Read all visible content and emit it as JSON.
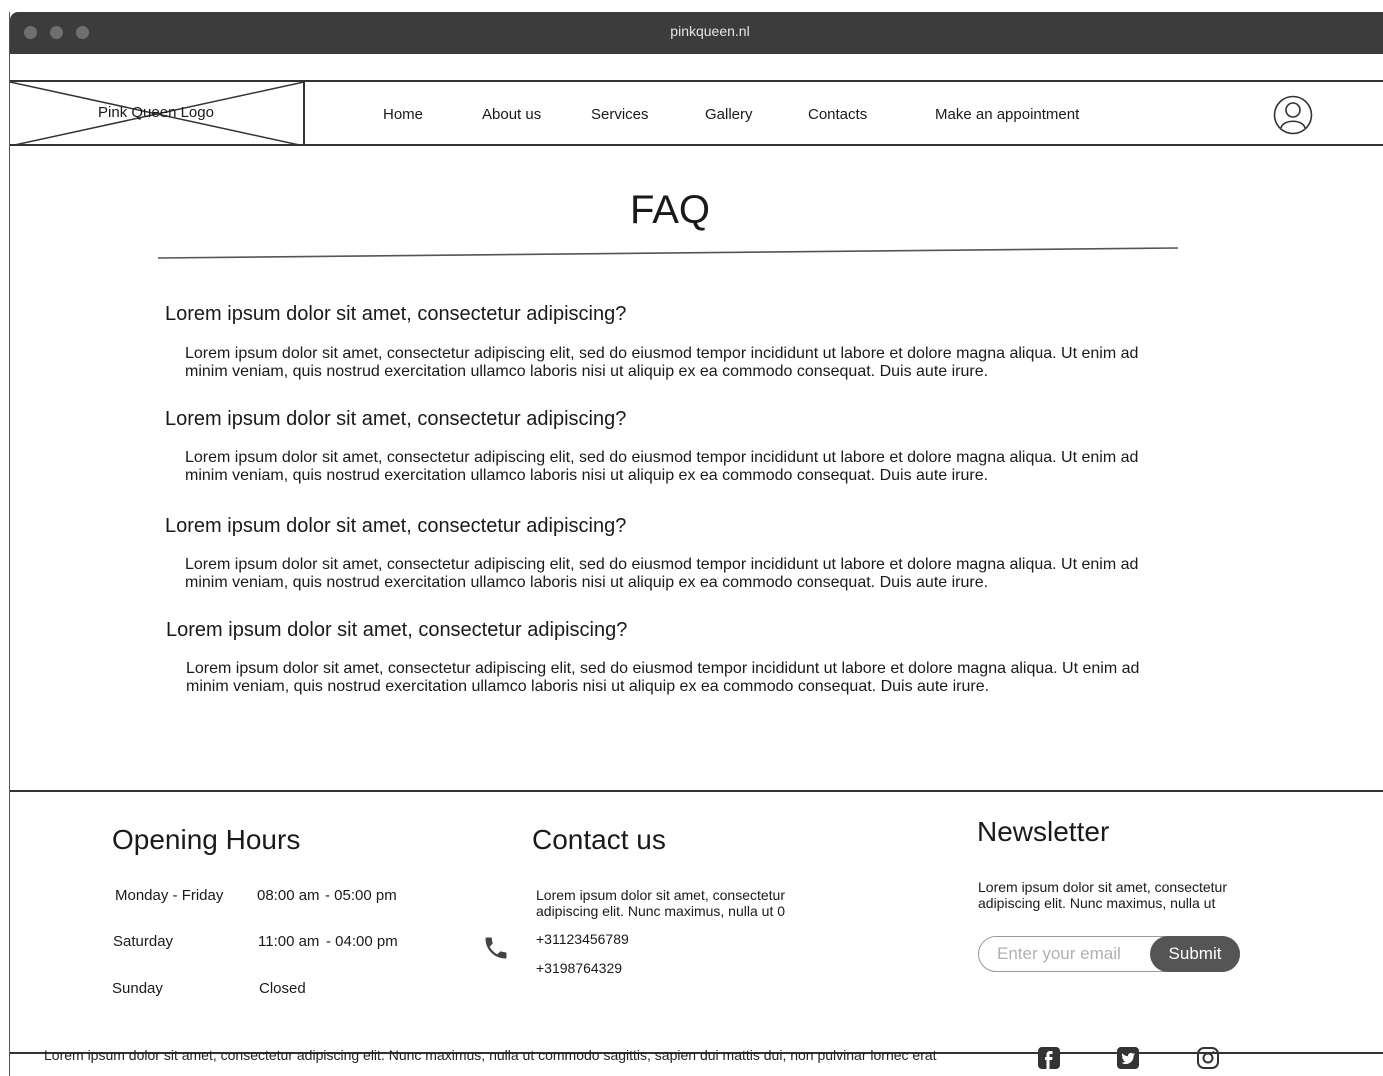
{
  "browser": {
    "url": "pinkqueen.nl"
  },
  "header": {
    "logo_text": "Pink Queen Logo",
    "nav": [
      {
        "label": "Home"
      },
      {
        "label": "About us"
      },
      {
        "label": "Services"
      },
      {
        "label": "Gallery"
      },
      {
        "label": "Contacts"
      },
      {
        "label": "Make an appointment"
      }
    ],
    "user_icon": "user-icon"
  },
  "main": {
    "title": "FAQ",
    "faqs": [
      {
        "question": "Lorem ipsum dolor sit amet, consectetur adipiscing?",
        "answer": "Lorem ipsum dolor sit amet, consectetur adipiscing elit, sed do eiusmod tempor incididunt ut labore et dolore magna aliqua. Ut enim ad minim veniam, quis nostrud exercitation ullamco laboris nisi ut aliquip ex ea commodo consequat. Duis aute irure."
      },
      {
        "question": "Lorem ipsum dolor sit amet, consectetur adipiscing?",
        "answer": "Lorem ipsum dolor sit amet, consectetur adipiscing elit, sed do eiusmod tempor incididunt ut labore et dolore magna aliqua. Ut enim ad minim veniam, quis nostrud exercitation ullamco laboris nisi ut aliquip ex ea commodo consequat. Duis aute irure."
      },
      {
        "question": "Lorem ipsum dolor sit amet, consectetur adipiscing?",
        "answer": "Lorem ipsum dolor sit amet, consectetur adipiscing elit, sed do eiusmod tempor incididunt ut labore et dolore magna aliqua. Ut enim ad minim veniam, quis nostrud exercitation ullamco laboris nisi ut aliquip ex ea commodo consequat. Duis aute irure."
      },
      {
        "question": "Lorem ipsum dolor sit amet, consectetur adipiscing?",
        "answer": "Lorem ipsum dolor sit amet, consectetur adipiscing elit, sed do eiusmod tempor incididunt ut labore et dolore magna aliqua. Ut enim ad minim veniam, quis nostrud exercitation ullamco laboris nisi ut aliquip ex ea commodo consequat. Duis aute irure."
      }
    ]
  },
  "footer": {
    "hours": {
      "title": "Opening Hours",
      "rows": [
        {
          "day": "Monday - Friday",
          "open": "08:00 am",
          "close": "- 05:00 pm"
        },
        {
          "day": "Saturday",
          "open": "11:00 am",
          "close": "- 04:00 pm"
        },
        {
          "day": "Sunday",
          "open": "Closed",
          "close": ""
        }
      ]
    },
    "contact": {
      "title": "Contact us",
      "text_line1": "Lorem ipsum dolor sit amet, consectetur",
      "text_line2": "adipiscing elit. Nunc maximus, nulla ut 0",
      "phone1": "+31123456789",
      "phone2": "+3198764329",
      "icon": "phone-icon"
    },
    "newsletter": {
      "title": "Newsletter",
      "text_line1": "Lorem ipsum dolor sit amet, consectetur",
      "text_line2": "adipiscing elit. Nunc maximus, nulla ut",
      "email_placeholder": "Enter your email",
      "submit_label": "Submit"
    }
  },
  "bottom_bar": {
    "text": "Lorem ipsum dolor sit amet, consectetur adipiscing elit. Nunc maximus, nulla ut commodo sagittis, sapien dui mattis dui, non pulvinar lornec erat",
    "social_icons": [
      "facebook-icon",
      "twitter-icon",
      "instagram-icon"
    ]
  }
}
